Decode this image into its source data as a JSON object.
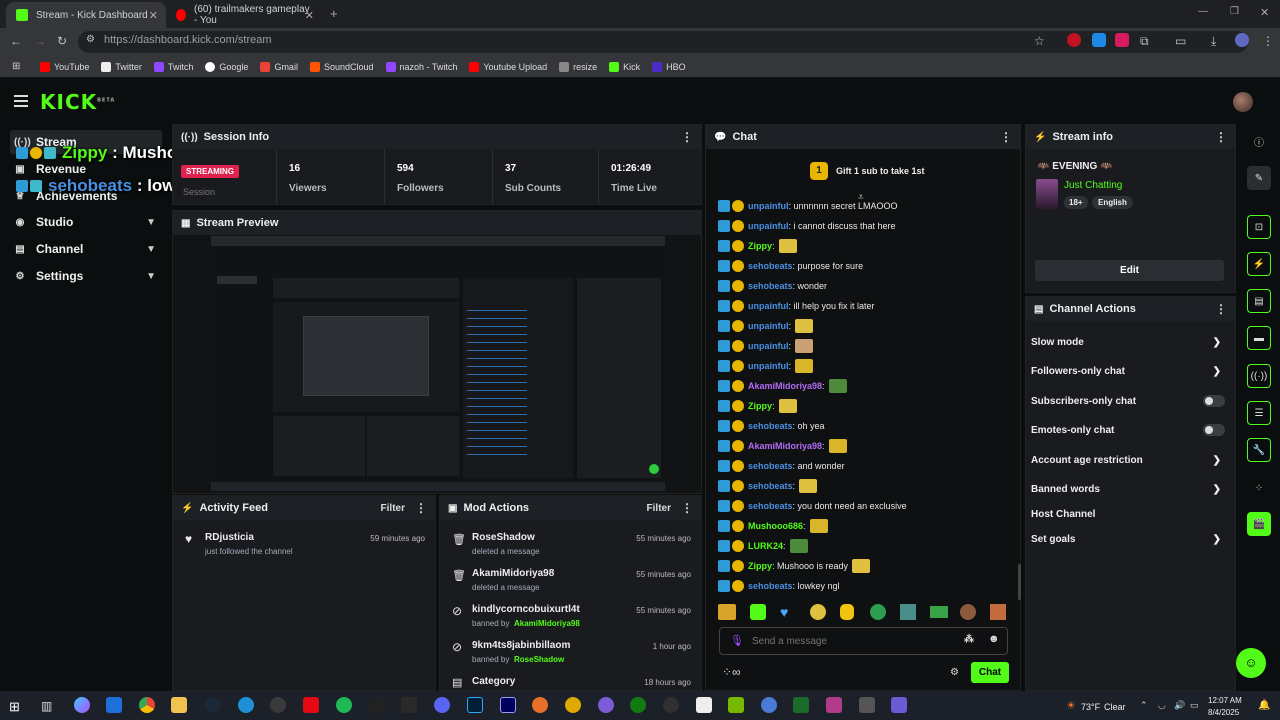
{
  "browser": {
    "tabs": [
      {
        "label": "Stream - Kick Dashboard"
      },
      {
        "label": "(60) trailmakers gameplay - You"
      }
    ],
    "url": "https://dashboard.kick.com/stream",
    "bookmarks": [
      "YouTube",
      "Twitter",
      "Twitch",
      "Google",
      "Gmail",
      "SoundCloud",
      "nazoh - Twitch",
      "Youtube Upload",
      "resize",
      "Kick",
      "HBO"
    ]
  },
  "colors": {
    "accent": "#53fc18",
    "streaming": "#e0224f",
    "username_blue": "#4a90e2",
    "username_green": "#53fc18",
    "username_purple": "#b26cf5"
  },
  "app": {
    "logo": "KICK",
    "logo_beta": "BETA",
    "sidebar": [
      {
        "label": "Stream",
        "icon": "broadcast-icon"
      },
      {
        "label": "Revenue",
        "icon": "revenue-icon"
      },
      {
        "label": "Achievements",
        "icon": "trophy-icon"
      },
      {
        "label": "Studio",
        "icon": "studio-icon"
      },
      {
        "label": "Channel",
        "icon": "channel-icon"
      },
      {
        "label": "Settings",
        "icon": "gear-icon"
      }
    ],
    "overlay_chat": [
      {
        "user": "Zippy",
        "sep": " : ",
        "text": "Mushooo is ready"
      },
      {
        "user": "sehobeats",
        "sep": " : ",
        "text": "lowkey ngl"
      }
    ]
  },
  "session_info": {
    "title": "Session Info",
    "status": "STREAMING",
    "status_sub": "Session",
    "stats": [
      {
        "value": "16",
        "label": "Viewers"
      },
      {
        "value": "594",
        "label": "Followers"
      },
      {
        "value": "37",
        "label": "Sub Counts"
      },
      {
        "value": "01:26:49",
        "label": "Time Live"
      }
    ]
  },
  "stream_preview": {
    "title": "Stream Preview"
  },
  "activity_feed": {
    "title": "Activity Feed",
    "filter": "Filter",
    "items": [
      {
        "name": "RDjusticia",
        "sub": "just followed the channel",
        "time": "59 minutes ago"
      }
    ]
  },
  "mod_actions": {
    "title": "Mod Actions",
    "filter": "Filter",
    "items": [
      {
        "name": "RoseShadow",
        "sub": "deleted a message",
        "by": "",
        "time": "55 minutes ago",
        "icon": "trash-icon"
      },
      {
        "name": "AkamiMidoriya98",
        "sub": "deleted a message",
        "by": "",
        "time": "55 minutes ago",
        "icon": "trash-icon"
      },
      {
        "name": "kindlycorncobuixurtl4t",
        "sub": "banned by",
        "by": "AkamiMidoriya98",
        "time": "55 minutes ago",
        "icon": "ban-icon"
      },
      {
        "name": "9km4ts8jabinbillaom",
        "sub": "banned by",
        "by": "RoseShadow",
        "time": "1 hour ago",
        "icon": "ban-icon"
      },
      {
        "name": "Category",
        "sub": "",
        "by": "",
        "time": "18 hours ago",
        "icon": "category-icon"
      }
    ]
  },
  "chat": {
    "title": "Chat",
    "pinned": "Gift 1 sub to take 1st",
    "messages": [
      {
        "user": "unpainful",
        "text": ": unnnnnn secret LMAOOO",
        "color": "#4a90e2"
      },
      {
        "user": "unpainful",
        "text": ": i cannot discuss that here",
        "color": "#4a90e2"
      },
      {
        "user": "Zippy",
        "text": ":",
        "color": "#53fc18",
        "emote": true
      },
      {
        "user": "sehobeats",
        "text": ": purpose for sure",
        "color": "#4a90e2"
      },
      {
        "user": "sehobeats",
        "text": ": wonder",
        "color": "#4a90e2"
      },
      {
        "user": "unpainful",
        "text": ": ill help you fix it later",
        "color": "#4a90e2"
      },
      {
        "user": "unpainful",
        "text": ":",
        "color": "#4a90e2",
        "emote": true
      },
      {
        "user": "unpainful",
        "text": ":",
        "color": "#4a90e2",
        "emote": true
      },
      {
        "user": "unpainful",
        "text": ":",
        "color": "#4a90e2",
        "emote": true
      },
      {
        "user": "AkamiMidoriya98",
        "text": ":",
        "color": "#b26cf5",
        "emote": true
      },
      {
        "user": "Zippy",
        "text": ":",
        "color": "#53fc18",
        "emote": true
      },
      {
        "user": "sehobeats",
        "text": ": oh yea",
        "color": "#4a90e2"
      },
      {
        "user": "AkamiMidoriya98",
        "text": ":",
        "color": "#b26cf5",
        "emote": true
      },
      {
        "user": "sehobeats",
        "text": ": and wonder",
        "color": "#4a90e2"
      },
      {
        "user": "sehobeats",
        "text": ":",
        "color": "#4a90e2",
        "emote": true
      },
      {
        "user": "sehobeats",
        "text": ": you dont need an exclusive",
        "color": "#4a90e2"
      },
      {
        "user": "Mushooo686",
        "text": ":",
        "color": "#53fc18",
        "emote": true
      },
      {
        "user": "LURK24",
        "text": ":",
        "color": "#53fc18",
        "emote": true
      },
      {
        "user": "Zippy",
        "text": ": Mushooo is ready",
        "color": "#53fc18",
        "emote": true
      },
      {
        "user": "sehobeats",
        "text": ": lowkey ngl",
        "color": "#4a90e2"
      }
    ],
    "placeholder": "Send a message",
    "send_label": "Chat"
  },
  "stream_info": {
    "title": "Stream info",
    "stream_title": "EVENING",
    "category": "Just Chatting",
    "tags": [
      "18+",
      "English"
    ],
    "edit_label": "Edit"
  },
  "channel_actions": {
    "title": "Channel Actions",
    "items": [
      {
        "label": "Slow mode",
        "control": "chevron"
      },
      {
        "label": "Followers-only chat",
        "control": "chevron"
      },
      {
        "label": "Subscribers-only chat",
        "control": "toggle"
      },
      {
        "label": "Emotes-only chat",
        "control": "toggle"
      },
      {
        "label": "Account age restriction",
        "control": "chevron"
      },
      {
        "label": "Banned words",
        "control": "chevron"
      },
      {
        "label": "Host Channel",
        "control": "none"
      },
      {
        "label": "Set goals",
        "control": "chevron"
      }
    ]
  },
  "taskbar": {
    "weather": "73°F",
    "weather_text": "Clear",
    "time": "12:07 AM",
    "date": "8/4/2025"
  }
}
